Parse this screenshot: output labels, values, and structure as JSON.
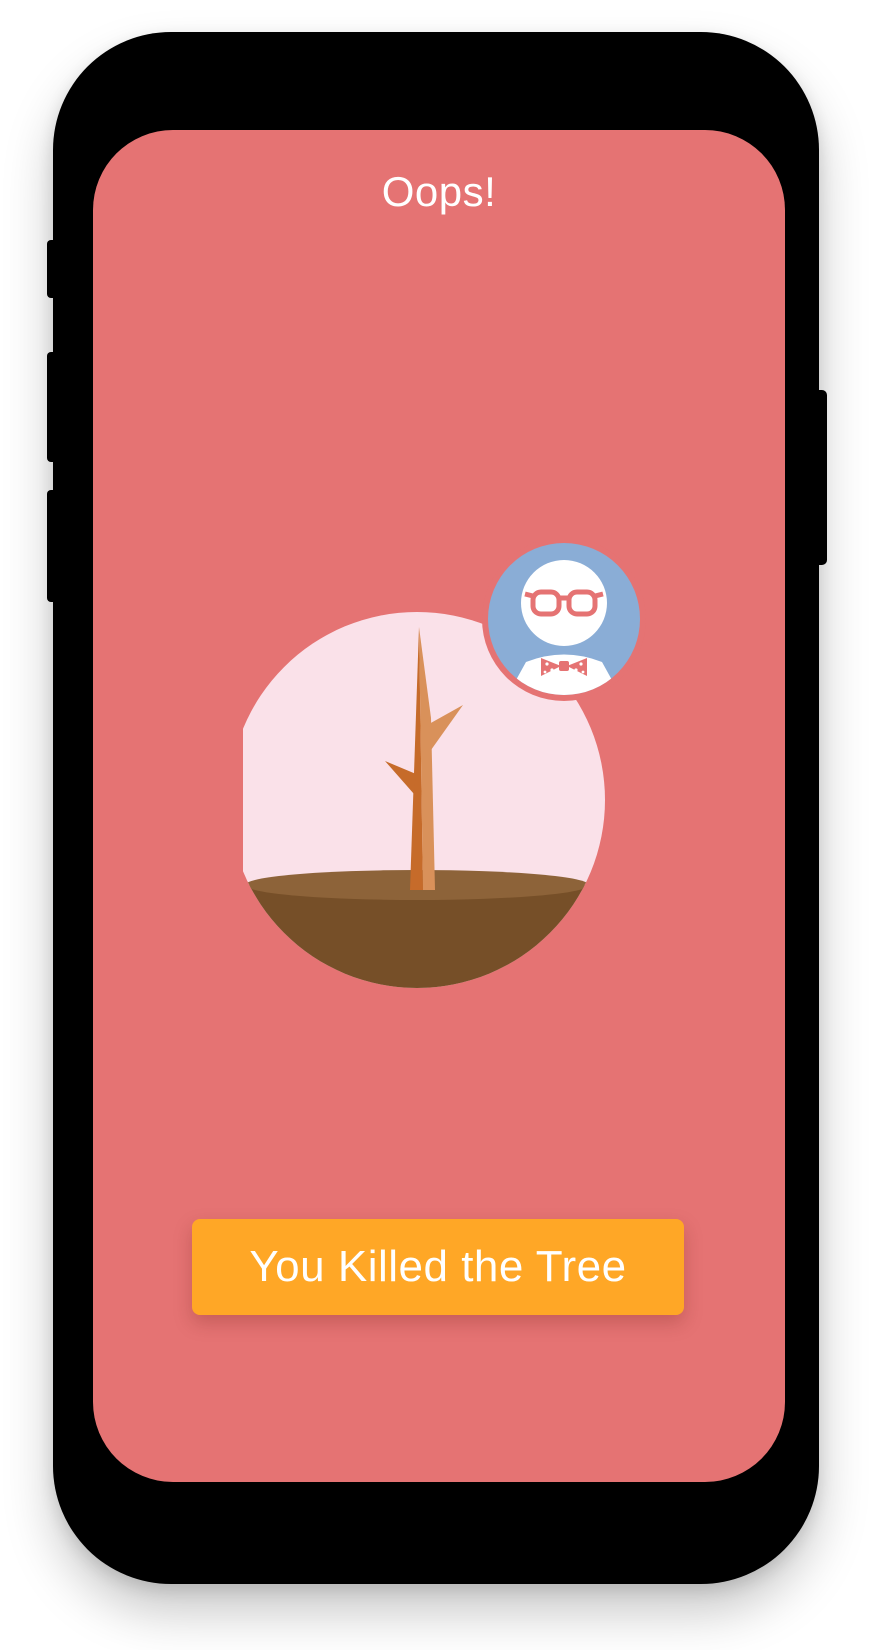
{
  "screen": {
    "title": "Oops!",
    "background_color": "#e57373"
  },
  "illustration": {
    "scene": "dead-tree-icon",
    "avatar": "nerd-avatar-icon",
    "colors": {
      "globe": "#fae1e9",
      "soil": "#764f28",
      "soil_top": "#8d6339",
      "trunk_dark": "#c66b2a",
      "trunk_light": "#d9915a",
      "avatar_bg": "#8aadd6",
      "glasses": "#e57373"
    }
  },
  "action_button": {
    "label": "You Killed the Tree",
    "color": "#ffa726"
  }
}
